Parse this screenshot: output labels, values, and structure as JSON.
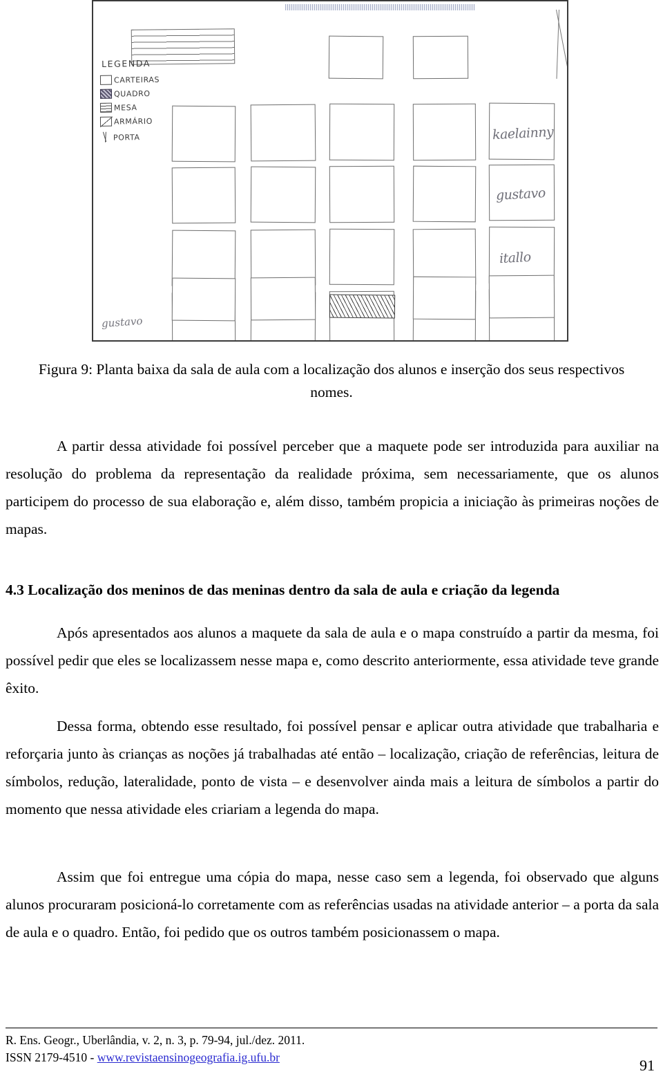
{
  "figure": {
    "legend": {
      "title": "LEGENDA",
      "items": [
        {
          "symbol": "empty-square",
          "label": "CARTEIRAS"
        },
        {
          "symbol": "filled-square",
          "label": "QUADRO"
        },
        {
          "symbol": "striped-square",
          "label": "MESA"
        },
        {
          "symbol": "diagonal-square",
          "label": "ARMÁRIO"
        },
        {
          "symbol": "v-shape",
          "label": "PORTA"
        }
      ]
    },
    "handwritten_names": [
      "kaelainny",
      "gustavo",
      "itallo"
    ],
    "signature": "gustavo",
    "desk_grid": {
      "rows": 6,
      "columns": 5,
      "note": "hand-drawn classroom floor plan with rectangular desks"
    }
  },
  "caption": "Figura 9: Planta baixa da sala de aula com a localização dos alunos e inserção dos seus respectivos nomes.",
  "paragraphs": {
    "p1": "A partir dessa atividade foi possível perceber que a maquete pode ser introduzida para auxiliar na resolução do problema da representação da realidade próxima, sem necessariamente, que os alunos participem do processo de sua elaboração e, além disso, também propicia a iniciação às primeiras noções de mapas.",
    "p2": "Após apresentados aos alunos a maquete da sala de aula e o mapa construído a partir da mesma, foi possível pedir que eles se localizassem nesse mapa e, como descrito anteriormente, essa atividade teve grande êxito.",
    "p3": "Dessa forma, obtendo esse resultado, foi possível pensar e aplicar outra atividade que trabalharia e reforçaria junto às crianças as noções já trabalhadas até então – localização, criação de referências, leitura de símbolos, redução, lateralidade, ponto de vista – e desenvolver ainda mais a leitura de símbolos a partir do momento que nessa atividade eles criariam a legenda do mapa.",
    "p4": "Assim que foi entregue uma cópia do mapa, nesse caso sem a legenda, foi observado que alguns alunos procuraram posicioná-lo corretamente com as referências usadas na atividade anterior – a porta da sala de aula e o quadro. Então, foi pedido que os outros também posicionassem o mapa."
  },
  "section_heading": "4.3 Localização dos meninos de das meninas dentro da sala de aula e criação da legenda",
  "footer": {
    "line1": "R. Ens. Geogr., Uberlândia,  v. 2, n. 3, p. 79-94, jul./dez. 2011.",
    "issn_prefix": "ISSN 2179-4510 - ",
    "url": "www.revistaensinogeografia.ig.ufu.br",
    "page_number": "91"
  }
}
